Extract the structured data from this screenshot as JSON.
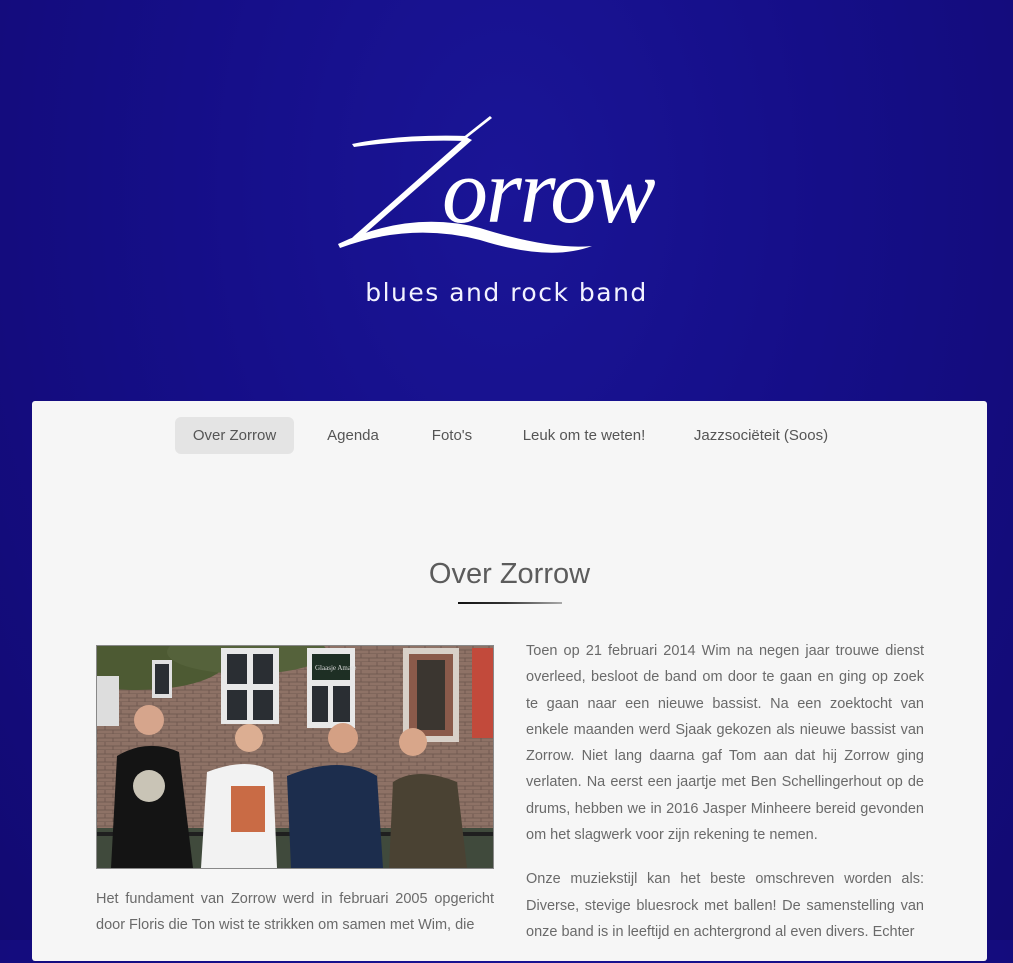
{
  "header": {
    "logo_text": "Zorrow",
    "tagline": "blues and rock band"
  },
  "nav": {
    "items": [
      {
        "label": "Over Zorrow",
        "active": true
      },
      {
        "label": "Agenda",
        "active": false
      },
      {
        "label": "Foto's",
        "active": false
      },
      {
        "label": "Leuk om te weten!",
        "active": false
      },
      {
        "label": "Jazzsociëteit (Soos)",
        "active": false
      }
    ]
  },
  "main": {
    "title": "Over Zorrow",
    "paragraph_right_1": "Toen op 21 februari 2014 Wim na negen jaar trouwe dienst overleed, besloot de band om door te gaan en ging op zoek te gaan naar een nieuwe bassist. Na een zoektocht van enkele maanden werd Sjaak gekozen als nieuwe bassist van Zorrow. Niet lang daarna gaf Tom aan dat hij Zorrow ging verlaten. Na eerst een jaartje met Ben Schellingerhout op de drums, hebben we in 2016 Jasper Minheere bereid gevonden om het slagwerk voor zijn rekening te nemen.",
    "paragraph_right_2": "Onze muziekstijl kan het beste omschreven worden als: Diverse, stevige bluesrock met ballen! De samenstelling van onze band is in leeftijd en achtergrond al even divers. Echter",
    "paragraph_left_1": "Het fundament van Zorrow werd in februari 2005 opgericht door Floris die Ton wist te strikken om samen met Wim, die",
    "photo_sign": "Glaasje Amare"
  },
  "colors": {
    "background": "#150e88",
    "card": "#f6f6f6",
    "nav_active": "#e4e4e4",
    "body_text": "#6a6a6a"
  }
}
